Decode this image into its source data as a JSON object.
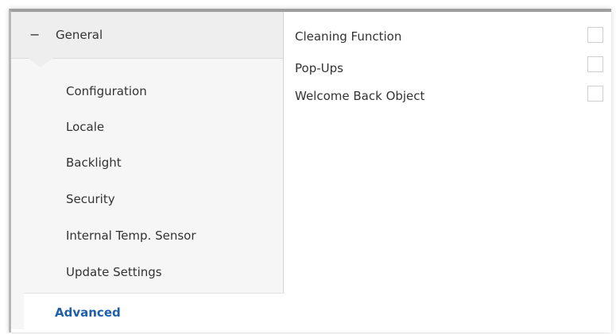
{
  "sidebar": {
    "group": {
      "collapse_symbol": "−",
      "title": "General"
    },
    "items": [
      {
        "label": "Configuration"
      },
      {
        "label": "Locale"
      },
      {
        "label": "Backlight"
      },
      {
        "label": "Security"
      },
      {
        "label": "Internal Temp. Sensor"
      },
      {
        "label": "Update Settings"
      },
      {
        "label": "Advanced"
      }
    ],
    "active_item": "Advanced"
  },
  "content": {
    "options": [
      {
        "label": "Cleaning Function",
        "checked": false
      },
      {
        "label": "Pop-Ups",
        "checked": false
      },
      {
        "label": "Welcome Back Object",
        "checked": false
      }
    ]
  },
  "colors": {
    "active_text": "#1f5fa6",
    "sidebar_bg": "#f6f6f6",
    "header_bg": "#eeeeee"
  }
}
